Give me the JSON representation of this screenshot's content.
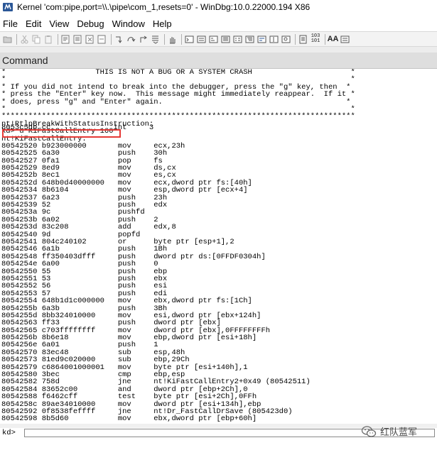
{
  "window": {
    "title": "Kernel 'com:pipe,port=\\\\.\\pipe\\com_1,resets=0' - WinDbg:10.0.22000.194 X86"
  },
  "menu": {
    "items": [
      "File",
      "Edit",
      "View",
      "Debug",
      "Window",
      "Help"
    ]
  },
  "toolbar": {
    "numbers_label": "103\n101",
    "font_label": "AA"
  },
  "command_window": {
    "title": "Command"
  },
  "output_lines": [
    "*                    THIS IS NOT A BUG OR A SYSTEM CRASH                      *",
    "*                                                                             *",
    "* If you did not intend to break into the debugger, press the \"g\" key, then  *",
    "* press the \"Enter\" key now.  This message might immediately reappear.  If it *",
    "* does, press \"g\" and \"Enter\" again.                                         *",
    "*                                                                             *",
    "*******************************************************************************",
    "nt!RtlpBreakWithStatusInstruction:",
    "kd> u KiFastCallEntry 160",
    "nt!KiFastCallEntry:",
    "80542520 b923000000       mov     ecx,23h",
    "80542525 6a30             push    30h",
    "80542527 0fa1             pop     fs",
    "80542529 8ed9             mov     ds,cx",
    "8054252b 8ec1             mov     es,cx",
    "8054252d 648b0d40000000   mov     ecx,dword ptr fs:[40h]",
    "80542534 8b6104           mov     esp,dword ptr [ecx+4]",
    "80542537 6a23             push    23h",
    "80542539 52               push    edx",
    "8054253a 9c               pushfd",
    "8054253b 6a02             push    2",
    "8054253d 83c208           add     edx,8",
    "80542540 9d               popfd",
    "80542541 804c240102       or      byte ptr [esp+1],2",
    "80542546 6a1b             push    1Bh",
    "80542548 ff350403dfff     push    dword ptr ds:[0FFDF0304h]",
    "8054254e 6a00             push    0",
    "80542550 55               push    ebp",
    "80542551 53               push    ebx",
    "80542552 56               push    esi",
    "80542553 57               push    edi",
    "80542554 648b1d1c000000   mov     ebx,dword ptr fs:[1Ch]",
    "8054255b 6a3b             push    3Bh",
    "8054255d 8bb324010000     mov     esi,dword ptr [ebx+124h]",
    "80542563 ff33             push    dword ptr [ebx]",
    "80542565 c703ffffffff     mov     dword ptr [ebx],0FFFFFFFFh",
    "8054256b 8b6e18           mov     ebp,dword ptr [esi+18h]",
    "8054256e 6a01             push    1",
    "80542570 83ec48           sub     esp,48h",
    "80542573 81ed9c020000     sub     ebp,29Ch",
    "80542579 c6864001000001   mov     byte ptr [esi+140h],1",
    "80542580 3bec             cmp     ebp,esp",
    "80542582 758d             jne     nt!KiFastCallEntry2+0x49 (80542511)",
    "80542584 83652c00         and     dword ptr [ebp+2Ch],0",
    "80542588 f6462cff         test    byte ptr [esi+2Ch],0FFh",
    "8054258c 89ae34010000     mov     dword ptr [esi+134h],ebp",
    "80542592 0f8538feffff     jne     nt!Dr_FastCallDrSave (805423d0)",
    "80542598 8b5d60           mov     ebx,dword ptr [ebp+60h]"
  ],
  "overlap_text": "8053c5db cc              int     3",
  "input": {
    "prompt": "kd>",
    "value": ""
  },
  "watermark": {
    "text": "红队蓝军"
  }
}
